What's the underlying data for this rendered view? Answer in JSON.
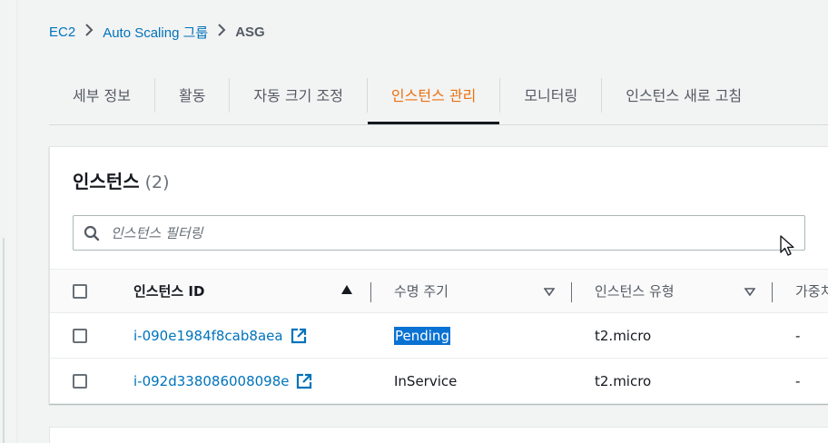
{
  "breadcrumb": {
    "items": [
      "EC2",
      "Auto Scaling 그룹"
    ],
    "current": "ASG"
  },
  "tabs": [
    "세부 정보",
    "활동",
    "자동 크기 조정",
    "인스턴스 관리",
    "모니터링",
    "인스턴스 새로 고침"
  ],
  "active_tab": "인스턴스 관리",
  "panel": {
    "title": "인스턴스",
    "count": "(2)",
    "filter_placeholder": "인스턴스 필터링"
  },
  "table": {
    "headers": [
      "인스턴스 ID",
      "수명 주기",
      "인스턴스 유형",
      "가중치"
    ],
    "header_visible": [
      "인스턴스 ID",
      "수명 주기",
      "인스턴스 유형",
      "가중치"
    ],
    "rows": [
      {
        "id": "i-090e1984f8cab8aea",
        "lifecycle": "Pending",
        "type": "t2.micro",
        "weight": "-"
      },
      {
        "id": "i-092d338086008098e",
        "lifecycle": "InService",
        "type": "t2.micro",
        "weight": "-"
      }
    ]
  },
  "colors": {
    "link": "#0073bb",
    "active_tab": "#ec7211",
    "selection": "#0972d3"
  }
}
